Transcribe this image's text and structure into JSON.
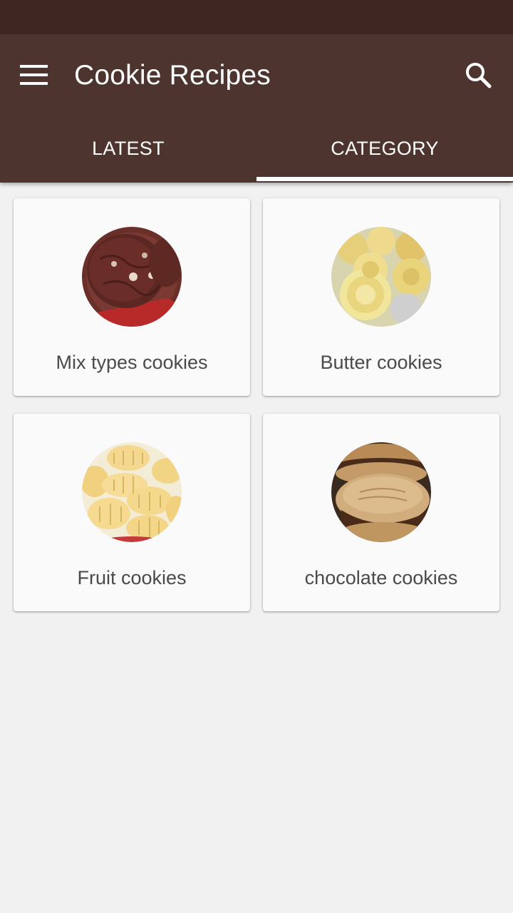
{
  "app": {
    "title": "Cookie Recipes",
    "colors": {
      "status_bar": "#3e2723",
      "primary": "#4e342e",
      "background": "#f1f1f1",
      "card": "#fafafa"
    }
  },
  "toolbar": {
    "menu_icon": "hamburger-menu-icon",
    "search_icon": "search-icon"
  },
  "tabs": [
    {
      "label": "LATEST",
      "selected": false
    },
    {
      "label": "CATEGORY",
      "selected": true
    }
  ],
  "categories": [
    {
      "label": "Mix types cookies",
      "image": "chocolate-chip-cookie-photo"
    },
    {
      "label": "Butter cookies",
      "image": "butter-cookie-photo"
    },
    {
      "label": "Fruit cookies",
      "image": "fork-pressed-cookie-photo"
    },
    {
      "label": "chocolate cookies",
      "image": "sandwich-cookie-photo"
    }
  ]
}
